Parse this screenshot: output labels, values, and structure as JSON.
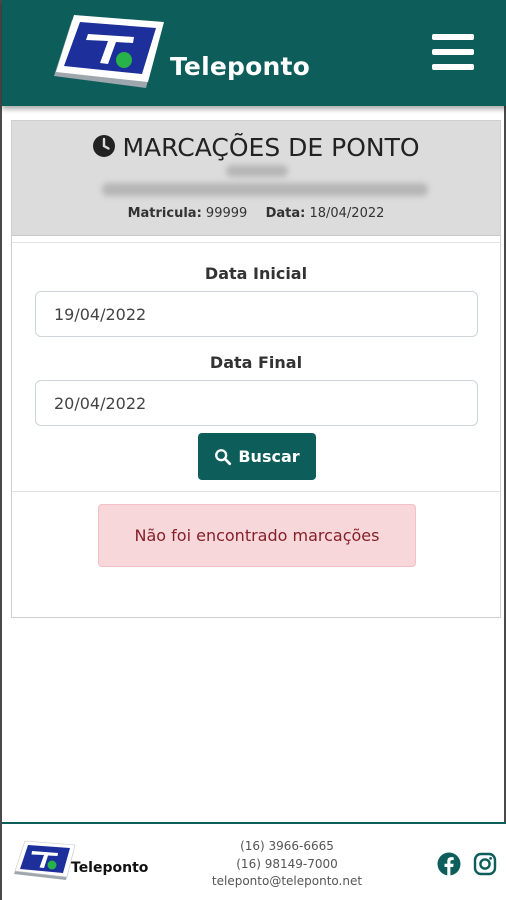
{
  "header": {
    "brand_name": "Teleponto",
    "menu_icon": "hamburger-menu-icon",
    "bg_color": "#0d5e5a"
  },
  "card": {
    "title": "MARCAÇÕES DE PONTO",
    "title_icon": "clock-icon",
    "matricula_label": "Matricula:",
    "matricula_value": "99999",
    "data_label": "Data:",
    "data_value": "18/04/2022"
  },
  "form": {
    "start_label": "Data Inicial",
    "start_value": "19/04/2022",
    "end_label": "Data Final",
    "end_value": "20/04/2022",
    "search_label": "Buscar",
    "search_icon": "search-icon"
  },
  "alert": {
    "message": "Não foi encontrado marcações",
    "bg_color": "#f8d7da",
    "text_color": "#842029"
  },
  "footer": {
    "brand_name": "Teleponto",
    "phone1": "(16) 3966-6665",
    "phone2": "(16) 98149-7000",
    "email": "teleponto@teleponto.net",
    "social_icons": [
      "facebook-icon",
      "instagram-icon"
    ]
  }
}
